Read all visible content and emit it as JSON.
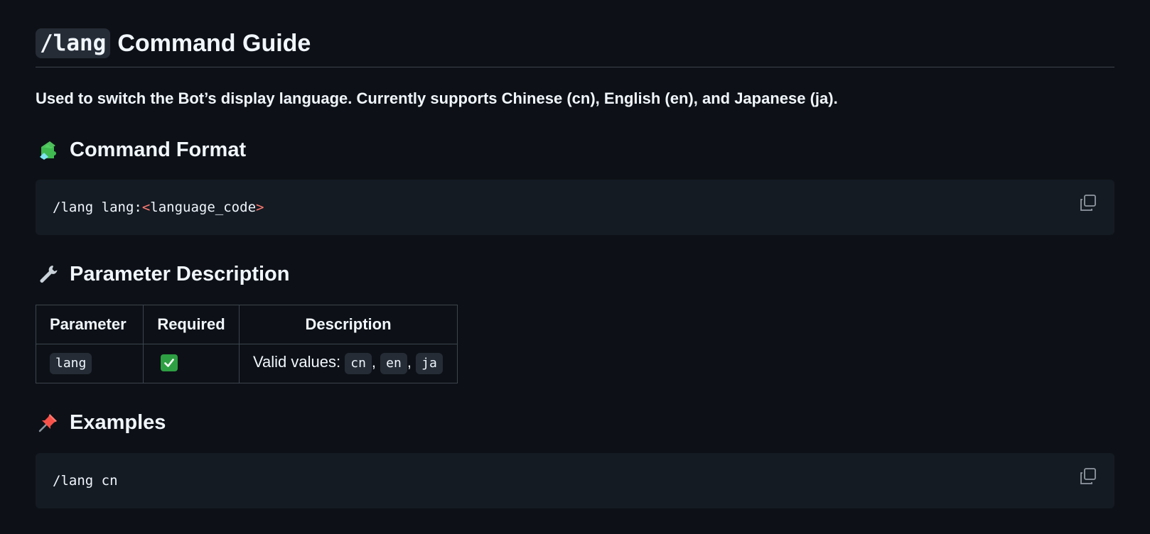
{
  "title": {
    "command": "/lang",
    "text": "Command Guide"
  },
  "intro": "Used to switch the Bot’s display language. Currently supports Chinese (cn), English (en), and Japanese (ja).",
  "sections": {
    "format": {
      "emoji": "puzzle-piece-icon",
      "heading": "Command Format",
      "code_prefix": "/lang lang:",
      "code_open": "<",
      "code_param": "language_code",
      "code_close": ">"
    },
    "params": {
      "emoji": "wrench-icon",
      "heading": "Parameter Description",
      "table": {
        "headers": [
          "Parameter",
          "Required",
          "Description"
        ],
        "rows": [
          {
            "parameter": "lang",
            "required": "check-mark-icon",
            "description_prefix": "Valid values:",
            "values": [
              "cn",
              "en",
              "ja"
            ],
            "separator": ","
          }
        ]
      }
    },
    "examples": {
      "emoji": "pushpin-icon",
      "heading": "Examples",
      "code": "/lang cn"
    }
  },
  "colors": {
    "background": "#0d1117",
    "code_background": "#151b23",
    "chip_background": "#262c36",
    "border": "#3d444d",
    "text": "#f0f6fc",
    "syntax_angle": "#ff7b72",
    "check_green": "#2ea043"
  }
}
